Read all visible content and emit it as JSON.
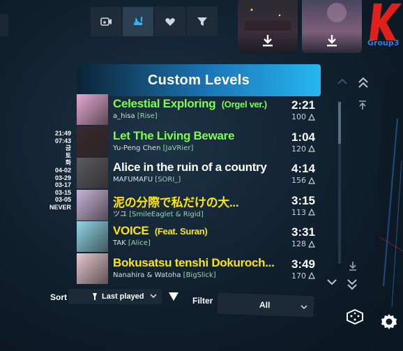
{
  "toolbar": {
    "buttons": [
      {
        "icon": "playlist-icon"
      },
      {
        "icon": "custom-levels-icon",
        "active": true
      },
      {
        "icon": "heart-icon"
      },
      {
        "icon": "filter-icon"
      }
    ]
  },
  "header": {
    "title": "Custom Levels"
  },
  "group_label": "Group3",
  "songs": [
    {
      "title": "Celestial Exploring",
      "title_suffix": "(Orgel ver.)",
      "author": "a_hisa",
      "mapper": "Rise",
      "duration": "2:21",
      "notes": "100",
      "title_color": "#7cff4c",
      "thumb": "#e7a8d2"
    },
    {
      "title": "Let The Living Beware",
      "title_suffix": "",
      "author": "Yu-Peng Chen",
      "mapper": "JaVRier",
      "duration": "1:04",
      "notes": "120",
      "title_color": "#7cff4c",
      "thumb": "#3a2a2e"
    },
    {
      "title": "Alice in the ruin of a country",
      "title_suffix": "",
      "author": "MAFUMAFU",
      "mapper": "SORI_",
      "duration": "4:14",
      "notes": "156",
      "title_color": "#ffffff",
      "thumb": "#5a5a60"
    },
    {
      "title": "泥の分際で私だけの大...",
      "title_suffix": "",
      "author": "ツユ",
      "mapper": "SmileEaglet & Rigid",
      "duration": "3:15",
      "notes": "113",
      "title_color": "#ffe600",
      "thumb": "#c9b4d8"
    },
    {
      "title": "VOICE",
      "title_suffix": "(Feat. Suran)",
      "author": "TAK",
      "mapper": "Alice",
      "duration": "3:31",
      "notes": "128",
      "title_color": "#ffe600",
      "thumb": "#8fd6e8"
    },
    {
      "title": "Bokusatsu tenshi Dokuroch...",
      "title_suffix": "",
      "author": "Nanahira & Watoha",
      "mapper": "BigSlick",
      "duration": "3:49",
      "notes": "170",
      "title_color": "#ffe600",
      "thumb": "#e7c7d0"
    }
  ],
  "dates": [
    "21:49",
    "07:43",
    "금",
    "토",
    "화",
    "04-02",
    "03-29",
    "03-17",
    "03-15",
    "03-05",
    "NEVER"
  ],
  "sort": {
    "label": "Sort",
    "value": "Last played"
  },
  "filter": {
    "label": "Filter",
    "value": "All"
  },
  "colors": {
    "accent": "#27b6ef",
    "group": "#3a7cd9",
    "logo": "#e0201a"
  }
}
